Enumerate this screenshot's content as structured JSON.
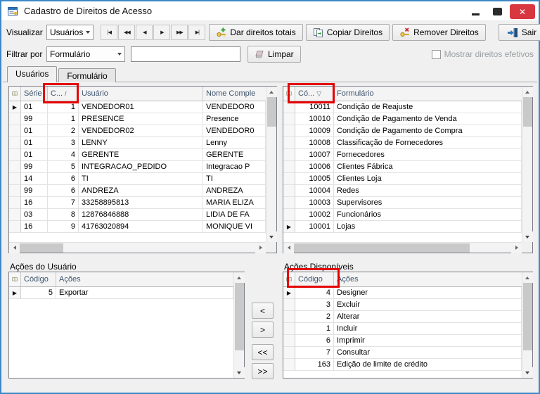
{
  "window": {
    "title": "Cadastro de Direitos de Acesso",
    "close_glyph": "✕"
  },
  "toolbar": {
    "view_label": "Visualizar",
    "view_value": "Usuários",
    "nav": [
      "|◀",
      "◀◀",
      "◀",
      "▶",
      "▶▶",
      "▶|"
    ],
    "grant_label": "Dar direitos totais",
    "copy_label": "Copiar Direitos",
    "remove_label": "Remover Direitos",
    "exit_label": "Sair"
  },
  "filter": {
    "label": "Filtrar por",
    "combo_value": "Formulário",
    "input_value": "",
    "clear_label": "Limpar",
    "effective_label": "Mostrar direitos efetivos",
    "effective_checked": false
  },
  "tabs": [
    {
      "label": "Usuários"
    },
    {
      "label": "Formulário"
    }
  ],
  "users_grid": {
    "headers": {
      "serie": "Série",
      "codigo": "C...",
      "sort": "/",
      "usuario": "Usuário",
      "nome": "Nome Comple"
    },
    "rows": [
      {
        "ind": "▶",
        "serie": "01",
        "codigo": "1",
        "usuario": "VENDEDOR01",
        "nome": "VENDEDOR0"
      },
      {
        "ind": "",
        "serie": "99",
        "codigo": "1",
        "usuario": "PRESENCE",
        "nome": "Presence"
      },
      {
        "ind": "",
        "serie": "01",
        "codigo": "2",
        "usuario": "VENDEDOR02",
        "nome": "VENDEDOR0"
      },
      {
        "ind": "",
        "serie": "01",
        "codigo": "3",
        "usuario": "LENNY",
        "nome": "Lenny"
      },
      {
        "ind": "",
        "serie": "01",
        "codigo": "4",
        "usuario": "GERENTE",
        "nome": "GERENTE"
      },
      {
        "ind": "",
        "serie": "99",
        "codigo": "5",
        "usuario": "INTEGRACAO_PEDIDO",
        "nome": "Integracao P"
      },
      {
        "ind": "",
        "serie": "14",
        "codigo": "6",
        "usuario": "TI",
        "nome": "TI"
      },
      {
        "ind": "",
        "serie": "99",
        "codigo": "6",
        "usuario": "ANDREZA",
        "nome": "ANDREZA"
      },
      {
        "ind": "",
        "serie": "16",
        "codigo": "7",
        "usuario": "33258895813",
        "nome": "MARIA ELIZA"
      },
      {
        "ind": "",
        "serie": "03",
        "codigo": "8",
        "usuario": "12876846888",
        "nome": "LIDIA DE FA"
      },
      {
        "ind": "",
        "serie": "16",
        "codigo": "9",
        "usuario": "41763020894",
        "nome": "MONIQUE VI"
      }
    ]
  },
  "forms_grid": {
    "headers": {
      "codigo": "Có...",
      "sort": "▽",
      "formulario": "Formulário"
    },
    "rows": [
      {
        "ind": "",
        "codigo": "10011",
        "formulario": "Condição de Reajuste"
      },
      {
        "ind": "",
        "codigo": "10010",
        "formulario": "Condição de Pagamento de Venda"
      },
      {
        "ind": "",
        "codigo": "10009",
        "formulario": "Condição de Pagamento de Compra"
      },
      {
        "ind": "",
        "codigo": "10008",
        "formulario": "Classificação de Fornecedores"
      },
      {
        "ind": "",
        "codigo": "10007",
        "formulario": "Fornecedores"
      },
      {
        "ind": "",
        "codigo": "10006",
        "formulario": "Clientes Fábrica"
      },
      {
        "ind": "",
        "codigo": "10005",
        "formulario": "Clientes Loja"
      },
      {
        "ind": "",
        "codigo": "10004",
        "formulario": "Redes"
      },
      {
        "ind": "",
        "codigo": "10003",
        "formulario": "Supervisores"
      },
      {
        "ind": "",
        "codigo": "10002",
        "formulario": "Funcionários"
      },
      {
        "ind": "▶",
        "codigo": "10001",
        "formulario": "Lojas"
      }
    ]
  },
  "user_actions": {
    "title": "Ações do Usuário",
    "headers": {
      "codigo": "Código",
      "acoes": "Ações"
    },
    "rows": [
      {
        "ind": "▶",
        "codigo": "5",
        "acoes": "Exportar"
      }
    ]
  },
  "transfer": [
    "<",
    ">",
    "<<",
    ">>"
  ],
  "available_actions": {
    "title": "Ações Disponíveis",
    "headers": {
      "codigo": "Código",
      "acoes": "Ações"
    },
    "rows": [
      {
        "ind": "▶",
        "codigo": "4",
        "acoes": "Designer"
      },
      {
        "ind": "",
        "codigo": "3",
        "acoes": "Excluir"
      },
      {
        "ind": "",
        "codigo": "2",
        "acoes": "Alterar"
      },
      {
        "ind": "",
        "codigo": "1",
        "acoes": "Incluir"
      },
      {
        "ind": "",
        "codigo": "6",
        "acoes": "Imprimir"
      },
      {
        "ind": "",
        "codigo": "7",
        "acoes": "Consultar"
      },
      {
        "ind": "",
        "codigo": "163",
        "acoes": "Edição de limite de crédito"
      }
    ]
  },
  "colors": {
    "annotation": "#e50000",
    "window_border": "#3c87c7",
    "close_button": "#d9373f"
  }
}
